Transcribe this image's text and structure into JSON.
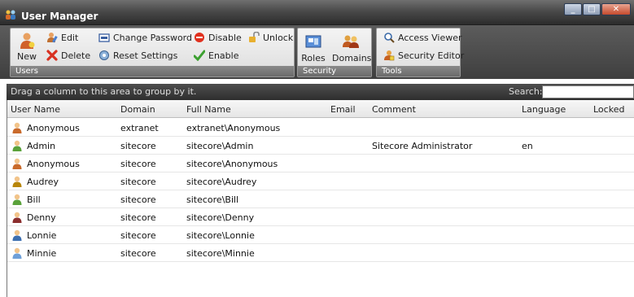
{
  "window": {
    "title": "User Manager"
  },
  "ribbon": {
    "users_group": {
      "label": "Users",
      "new_label": "New",
      "edit_label": "Edit",
      "delete_label": "Delete",
      "change_password_label": "Change Password",
      "reset_settings_label": "Reset Settings",
      "disable_label": "Disable",
      "enable_label": "Enable",
      "unlock_label": "Unlock"
    },
    "security_group": {
      "label": "Security",
      "roles_label": "Roles",
      "domains_label": "Domains"
    },
    "tools_group": {
      "label": "Tools",
      "access_viewer_label": "Access Viewer",
      "security_editor_label": "Security Editor"
    }
  },
  "groupbar": {
    "hint": "Drag a column to this area to group by it.",
    "search_label": "Search:"
  },
  "search": {
    "value": ""
  },
  "grid": {
    "columns": [
      "User Name",
      "Domain",
      "Full Name",
      "Email",
      "Comment",
      "Language",
      "Locked"
    ],
    "rows": [
      {
        "user": "Anonymous",
        "domain": "extranet",
        "full": "extranet\\Anonymous",
        "email": "",
        "comment": "",
        "language": "",
        "locked": "",
        "icon_color": "#c96a2b"
      },
      {
        "user": "Admin",
        "domain": "sitecore",
        "full": "sitecore\\Admin",
        "email": "",
        "comment": "Sitecore Administrator",
        "language": "en",
        "locked": "",
        "icon_color": "#5aa23a"
      },
      {
        "user": "Anonymous",
        "domain": "sitecore",
        "full": "sitecore\\Anonymous",
        "email": "",
        "comment": "",
        "language": "",
        "locked": "",
        "icon_color": "#c96a2b"
      },
      {
        "user": "Audrey",
        "domain": "sitecore",
        "full": "sitecore\\Audrey",
        "email": "",
        "comment": "",
        "language": "",
        "locked": "",
        "icon_color": "#b8860b"
      },
      {
        "user": "Bill",
        "domain": "sitecore",
        "full": "sitecore\\Bill",
        "email": "",
        "comment": "",
        "language": "",
        "locked": "",
        "icon_color": "#5aa23a"
      },
      {
        "user": "Denny",
        "domain": "sitecore",
        "full": "sitecore\\Denny",
        "email": "",
        "comment": "",
        "language": "",
        "locked": "",
        "icon_color": "#8b2e2e"
      },
      {
        "user": "Lonnie",
        "domain": "sitecore",
        "full": "sitecore\\Lonnie",
        "email": "",
        "comment": "",
        "language": "",
        "locked": "",
        "icon_color": "#3d6fb0"
      },
      {
        "user": "Minnie",
        "domain": "sitecore",
        "full": "sitecore\\Minnie",
        "email": "",
        "comment": "",
        "language": "",
        "locked": "",
        "icon_color": "#6fa0d8"
      }
    ]
  },
  "icons": {
    "app": "users-icon",
    "new": "new-user-icon",
    "edit": "edit-user-icon",
    "delete": "delete-icon",
    "change_password": "password-icon",
    "reset_settings": "reset-icon",
    "disable": "disable-icon",
    "enable": "check-icon",
    "unlock": "unlock-icon",
    "roles": "roles-icon",
    "domains": "domains-icon",
    "access_viewer": "access-viewer-icon",
    "security_editor": "security-editor-icon"
  }
}
